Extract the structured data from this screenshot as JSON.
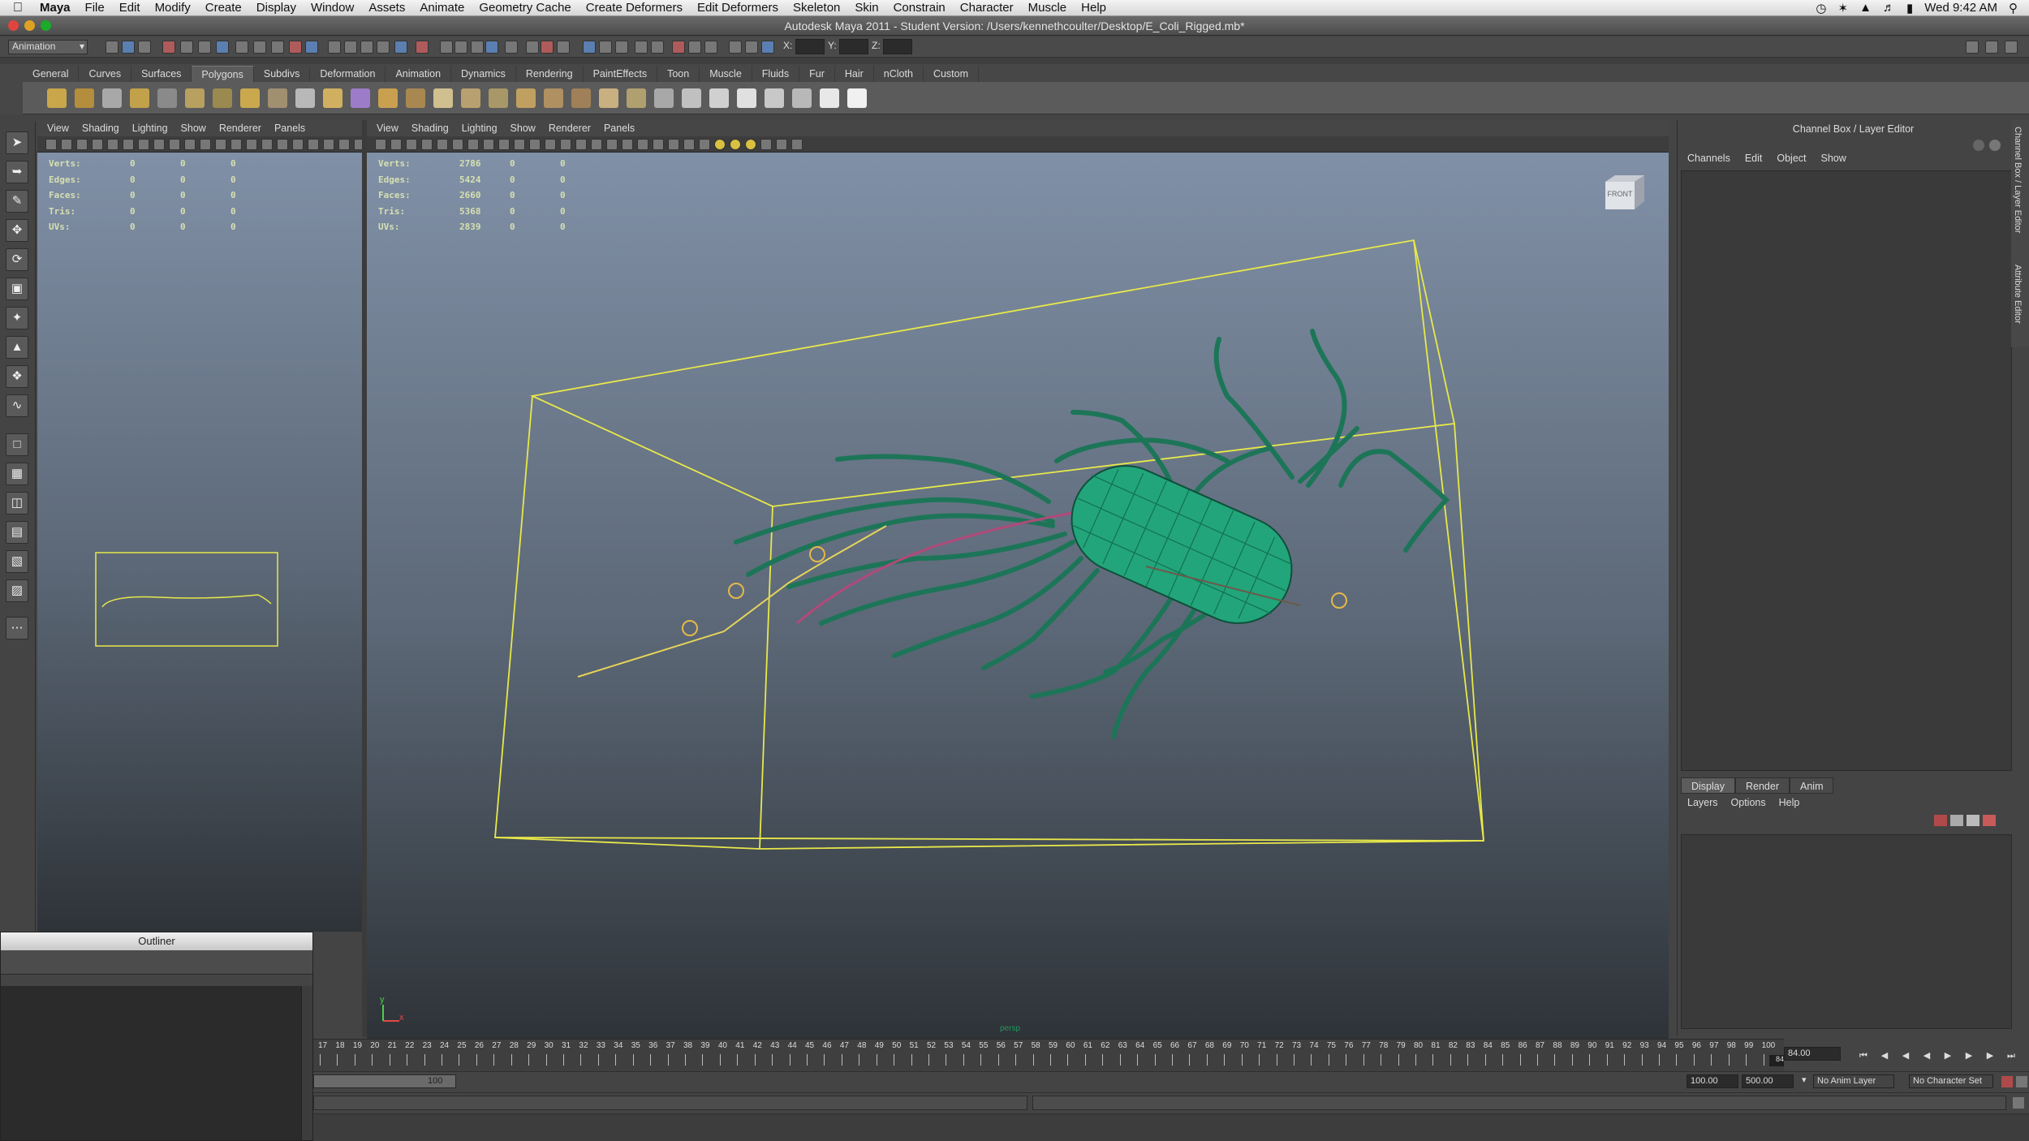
{
  "macmenu": {
    "app": "Maya",
    "items": [
      "File",
      "Edit",
      "Modify",
      "Create",
      "Display",
      "Window",
      "Assets",
      "Animate",
      "Geometry Cache",
      "Create Deformers",
      "Edit Deformers",
      "Skeleton",
      "Skin",
      "Constrain",
      "Character",
      "Muscle",
      "Help"
    ],
    "clock": "Wed 9:42 AM"
  },
  "window": {
    "title": "Autodesk Maya 2011 - Student Version: /Users/kennethcoulter/Desktop/E_Coli_Rigged.mb*"
  },
  "statusline": {
    "menuset": "Animation",
    "x_label": "X:",
    "y_label": "Y:",
    "z_label": "Z:"
  },
  "shelf": {
    "tabs": [
      "General",
      "Curves",
      "Surfaces",
      "Polygons",
      "Subdivs",
      "Deformation",
      "Animation",
      "Dynamics",
      "Rendering",
      "PaintEffects",
      "Toon",
      "Muscle",
      "Fluids",
      "Fur",
      "Hair",
      "nCloth",
      "Custom"
    ],
    "active": "Polygons"
  },
  "panel_menu": [
    "View",
    "Shading",
    "Lighting",
    "Show",
    "Renderer",
    "Panels"
  ],
  "hud_left": [
    {
      "label": "Verts:",
      "a": "0",
      "b": "0",
      "c": "0"
    },
    {
      "label": "Edges:",
      "a": "0",
      "b": "0",
      "c": "0"
    },
    {
      "label": "Faces:",
      "a": "0",
      "b": "0",
      "c": "0"
    },
    {
      "label": "Tris:",
      "a": "0",
      "b": "0",
      "c": "0"
    },
    {
      "label": "UVs:",
      "a": "0",
      "b": "0",
      "c": "0"
    }
  ],
  "hud_main": [
    {
      "label": "Verts:",
      "a": "2786",
      "b": "0",
      "c": "0"
    },
    {
      "label": "Edges:",
      "a": "5424",
      "b": "0",
      "c": "0"
    },
    {
      "label": "Faces:",
      "a": "2660",
      "b": "0",
      "c": "0"
    },
    {
      "label": "Tris:",
      "a": "5368",
      "b": "0",
      "c": "0"
    },
    {
      "label": "UVs:",
      "a": "2839",
      "b": "0",
      "c": "0"
    }
  ],
  "viewcube": "FRONT",
  "camera_label": "persp",
  "axis": {
    "x": "x",
    "y": "y"
  },
  "channelbox": {
    "title": "Channel Box / Layer Editor",
    "menu": [
      "Channels",
      "Edit",
      "Object",
      "Show"
    ],
    "layer_tabs": [
      "Display",
      "Render",
      "Anim"
    ],
    "layer_menu": [
      "Layers",
      "Options",
      "Help"
    ],
    "side_tabs": [
      "Channel Box / Layer Editor",
      "Attribute Editor"
    ]
  },
  "outliner": {
    "title": "Outliner"
  },
  "timeline": {
    "ticks": [
      "17",
      "18",
      "19",
      "20",
      "21",
      "22",
      "23",
      "24",
      "25",
      "26",
      "27",
      "28",
      "29",
      "30",
      "31",
      "32",
      "33",
      "34",
      "35",
      "36",
      "37",
      "38",
      "39",
      "40",
      "41",
      "42",
      "43",
      "44",
      "45",
      "46",
      "47",
      "48",
      "49",
      "50",
      "51",
      "52",
      "53",
      "54",
      "55",
      "56",
      "57",
      "58",
      "59",
      "60",
      "61",
      "62",
      "63",
      "64",
      "65",
      "66",
      "67",
      "68",
      "69",
      "70",
      "71",
      "72",
      "73",
      "74",
      "75",
      "76",
      "77",
      "78",
      "79",
      "80",
      "81",
      "82",
      "83",
      "84",
      "85",
      "86",
      "87",
      "88",
      "89",
      "90",
      "91",
      "92",
      "93",
      "94",
      "95",
      "96",
      "97",
      "98",
      "99",
      "100"
    ],
    "current_frame": "84.00",
    "current_marker": "84"
  },
  "range": {
    "slider_end": "100",
    "end_time": "100.00",
    "total": "500.00",
    "anim_layer": "No Anim Layer",
    "char_set": "No Character Set"
  }
}
